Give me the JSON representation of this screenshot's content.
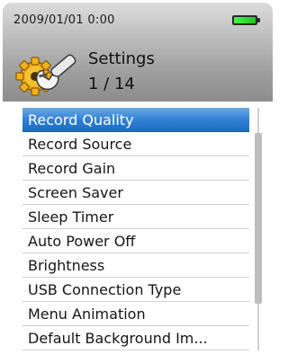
{
  "status": {
    "datetime": "2009/01/01   0:00",
    "battery_level": 1.0,
    "battery_color": "#2fd832"
  },
  "header": {
    "icon": "settings-gear-wrench-icon",
    "title": "Settings",
    "counter": "1 / 14"
  },
  "menu": {
    "selected_index": 0,
    "items": [
      {
        "label": "Record Quality"
      },
      {
        "label": "Record Source"
      },
      {
        "label": "Record Gain"
      },
      {
        "label": "Screen Saver"
      },
      {
        "label": "Sleep Timer"
      },
      {
        "label": "Auto Power Off"
      },
      {
        "label": "Brightness"
      },
      {
        "label": "USB Connection Type"
      },
      {
        "label": "Menu Animation"
      },
      {
        "label": "Default Background Im..."
      }
    ]
  },
  "colors": {
    "selection": "#2f7fd4",
    "header_bg": "#a9a9a9"
  }
}
